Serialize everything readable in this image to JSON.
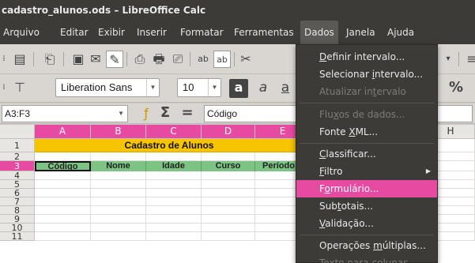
{
  "window": {
    "title": "cadastro_alunos.ods – LibreOffice Calc"
  },
  "menu": [
    "Arquivo",
    "Editar",
    "Exibir",
    "Inserir",
    "Formatar",
    "Ferramentas",
    "Dados",
    "Janela",
    "Ajuda"
  ],
  "toolbar": {
    "font_name": "Liberation Sans",
    "font_size": "10"
  },
  "formula": {
    "name_box": "A3:F3",
    "content": "Código"
  },
  "columns": [
    "A",
    "B",
    "C",
    "D",
    "E",
    "H"
  ],
  "rows": [
    "1",
    "2",
    "3",
    "4",
    "5",
    "6",
    "7",
    "8",
    "9",
    "10",
    "11"
  ],
  "sheet": {
    "title": "Cadastro de Alunos",
    "headers": [
      "Código",
      "Nome",
      "Idade",
      "Curso",
      "Período"
    ]
  },
  "dropdown": {
    "items": [
      {
        "label": "Definir intervalo...",
        "disabled": false
      },
      {
        "label": "Selecionar intervalo...",
        "disabled": false
      },
      {
        "label": "Atualizar intervalo",
        "disabled": true
      },
      {
        "label": "Fluxos de dados...",
        "disabled": true
      },
      {
        "label": "Fonte XML...",
        "disabled": false
      },
      {
        "label": "Classificar...",
        "disabled": false
      },
      {
        "label": "Filtro",
        "disabled": false
      },
      {
        "label": "Formulário...",
        "disabled": false,
        "highlighted": true
      },
      {
        "label": "Subtotais...",
        "disabled": false
      },
      {
        "label": "Validação...",
        "disabled": false
      },
      {
        "label": "Operações múltiplas...",
        "disabled": false
      },
      {
        "label": "Texto para colunas...",
        "disabled": true
      }
    ]
  },
  "colors": {
    "accent": "#e64aa1",
    "title_band": "#f6c400",
    "header_fill": "#7cc384",
    "menu_bg": "#3c3b37"
  }
}
